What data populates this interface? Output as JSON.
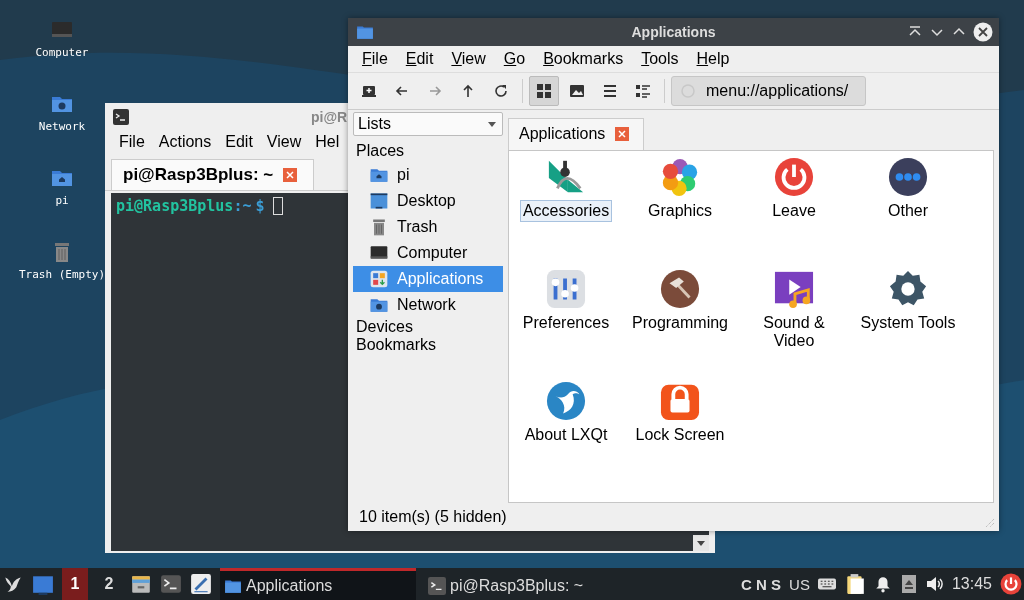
{
  "desktop_icons": [
    {
      "label": "Computer",
      "kind": "computer"
    },
    {
      "label": "Network",
      "kind": "network"
    },
    {
      "label": "pi",
      "kind": "home"
    },
    {
      "label": "Trash (Empty)",
      "kind": "trash"
    }
  ],
  "terminal": {
    "title": "pi@R",
    "menu": [
      "File",
      "Actions",
      "Edit",
      "View",
      "Hel"
    ],
    "tabs": [
      {
        "label": "pi@Rasp3Bplus: ~",
        "selected": true
      }
    ],
    "prompt_user": "pi@Rasp3Bplus",
    "prompt_path": ":~",
    "prompt_symbol": "$"
  },
  "file_manager": {
    "title": "Applications",
    "menu": [
      "File",
      "Edit",
      "View",
      "Go",
      "Bookmarks",
      "Tools",
      "Help"
    ],
    "toolbar": [
      {
        "kind": "new-tab",
        "disabled": false,
        "selected": false
      },
      {
        "kind": "back",
        "disabled": false,
        "selected": false
      },
      {
        "kind": "forward",
        "disabled": true,
        "selected": false
      },
      {
        "kind": "up",
        "disabled": false,
        "selected": false
      },
      {
        "kind": "reload",
        "disabled": false,
        "selected": false
      },
      {
        "kind": "icon-view",
        "disabled": false,
        "selected": true
      },
      {
        "kind": "thumbnail-view",
        "disabled": false,
        "selected": false
      },
      {
        "kind": "compact-view",
        "disabled": false,
        "selected": false
      },
      {
        "kind": "detailed-view",
        "disabled": false,
        "selected": false
      }
    ],
    "path": "menu://applications/",
    "side_pane_mode": "Lists",
    "tree": [
      {
        "label": "Places",
        "children": [
          {
            "label": "pi",
            "kind": "home",
            "selected": false
          },
          {
            "label": "Desktop",
            "kind": "desktop",
            "selected": false
          },
          {
            "label": "Trash",
            "kind": "trash",
            "selected": false
          },
          {
            "label": "Computer",
            "kind": "computer",
            "selected": false
          },
          {
            "label": "Applications",
            "kind": "applications",
            "selected": true
          },
          {
            "label": "Network",
            "kind": "network",
            "selected": false
          }
        ]
      },
      {
        "label": "Devices"
      },
      {
        "label": "Bookmarks"
      }
    ],
    "tabs": [
      {
        "label": "Applications",
        "selected": true
      }
    ],
    "items": [
      {
        "label": "Accessories",
        "kind": "accessories",
        "selected": true
      },
      {
        "label": "Graphics",
        "kind": "graphics",
        "selected": false
      },
      {
        "label": "Leave",
        "kind": "leave",
        "selected": false
      },
      {
        "label": "Other",
        "kind": "other",
        "selected": false
      },
      {
        "label": "Preferences",
        "kind": "preferences",
        "selected": false
      },
      {
        "label": "Programming",
        "kind": "programming",
        "selected": false
      },
      {
        "label": "Sound & Video",
        "kind": "sound-video",
        "selected": false
      },
      {
        "label": "System Tools",
        "kind": "system-tools",
        "selected": false
      },
      {
        "label": "About LXQt",
        "kind": "about",
        "selected": false
      },
      {
        "label": "Lock Screen",
        "kind": "lock",
        "selected": false
      }
    ],
    "status": "10 item(s) (5 hidden)"
  },
  "taskbar": {
    "workspaces": [
      {
        "label": "1",
        "selected": true
      },
      {
        "label": "2",
        "selected": false
      }
    ],
    "launchers": [
      {
        "kind": "file-manager"
      },
      {
        "kind": "terminal"
      },
      {
        "kind": "text-editor"
      }
    ],
    "tasks": [
      {
        "label": "Applications",
        "kind": "folder",
        "selected": true
      },
      {
        "label": "pi@Rasp3Bplus: ~",
        "kind": "terminal",
        "selected": false
      }
    ],
    "lock_keys": "C N S",
    "layout": "US",
    "clock": "13:45"
  }
}
